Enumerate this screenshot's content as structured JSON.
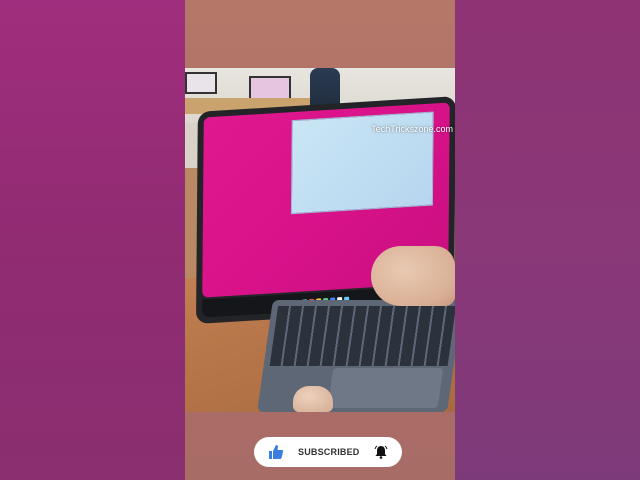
{
  "video": {
    "watermark": "TechTrickszone.com"
  },
  "subscribe_button": {
    "label": "SUBSCRIBED",
    "like_icon": "thumbs-up-icon",
    "bell_icon": "bell-icon",
    "accent_color": "#3b7de0"
  }
}
